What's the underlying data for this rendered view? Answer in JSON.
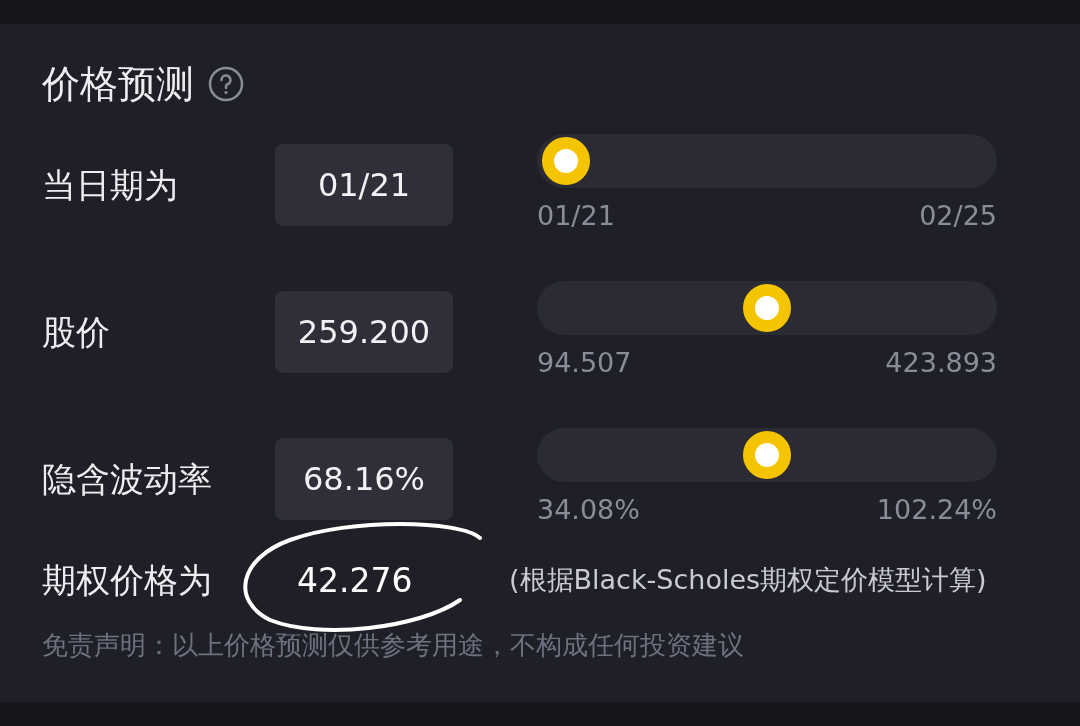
{
  "title": "价格预测",
  "params": [
    {
      "label": "当日期为",
      "value": "01/21",
      "level": 0,
      "min": "01/21",
      "max": "02/25"
    },
    {
      "label": "股价",
      "value": "259.200",
      "level": 0.5,
      "min": "94.507",
      "max": "423.893"
    },
    {
      "label": "隐含波动率",
      "value": "68.16%",
      "level": 0.5,
      "min": "34.08%",
      "max": "102.24%"
    }
  ],
  "result": {
    "label": "期权价格为",
    "value": "42.276",
    "note": "(根据Black-Scholes期权定价模型计算)"
  },
  "disclaimer": "免责声明：以上价格预测仅供参考用途，不构成任何投资建议"
}
